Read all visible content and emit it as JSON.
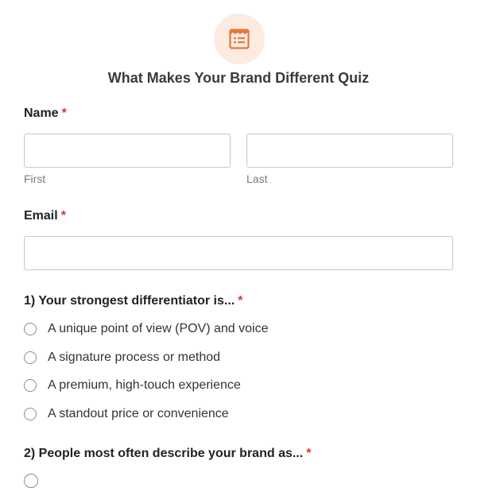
{
  "form": {
    "icon": "quiz-form-icon",
    "accent_color": "#e8773a",
    "title": "What Makes Your Brand Different Quiz"
  },
  "name_field": {
    "label": "Name",
    "required_mark": "*",
    "first_value": "",
    "first_sublabel": "First",
    "last_value": "",
    "last_sublabel": "Last"
  },
  "email_field": {
    "label": "Email",
    "required_mark": "*",
    "value": ""
  },
  "question1": {
    "label": "1) Your strongest differentiator is...",
    "required_mark": "*",
    "options": [
      "A unique point of view (POV) and voice",
      "A signature process or method",
      "A premium, high-touch experience",
      "A standout price or convenience"
    ]
  },
  "question2": {
    "label": "2) People most often describe your brand as...",
    "required_mark": "*"
  }
}
